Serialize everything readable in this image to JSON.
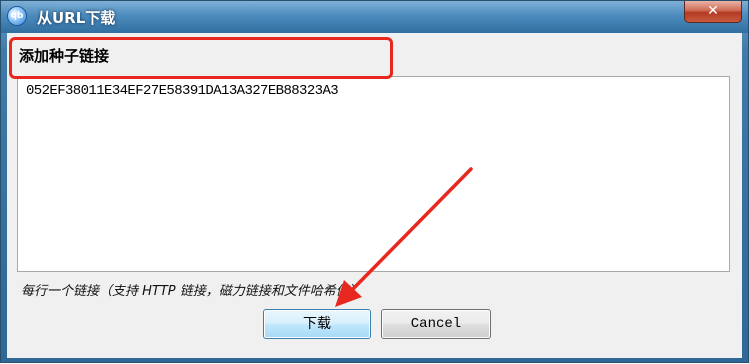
{
  "window": {
    "title": "从URL下载",
    "app_icon_text": "qb",
    "close_label": "✕"
  },
  "dialog": {
    "section_label": "添加种子链接",
    "links_value": "052EF38011E34EF27E58391DA13A327EB88323A3",
    "hint": "每行一个链接（支持 HTTP 链接，磁力链接和文件哈希值）",
    "download_label": "下载",
    "cancel_label": "Cancel"
  },
  "annotations": {
    "highlight_color": "#e8281e",
    "arrow_color": "#e8281e"
  }
}
